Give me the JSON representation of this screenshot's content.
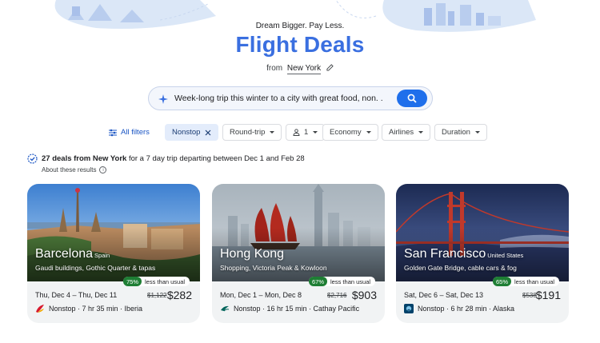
{
  "header": {
    "tagline": "Dream Bigger. Pay Less.",
    "title": "Flight Deals",
    "from_label": "from",
    "from_city": "New York"
  },
  "search": {
    "query": "Week-long trip this winter to a city with great food, non. ."
  },
  "filters": {
    "all_filters": "All filters",
    "nonstop": "Nonstop",
    "round_trip": "Round-trip",
    "passengers": "1",
    "cabin": "Economy",
    "airlines": "Airlines",
    "duration": "Duration"
  },
  "results": {
    "count_text": "27 deals from New York",
    "detail_text": " for a 7 day trip departing between Dec 1 and Feb 28",
    "about": "About these results",
    "info_glyph": "i"
  },
  "deals": [
    {
      "city": "Barcelona",
      "country": "Spain",
      "description": "Gaudi buildings, Gothic Quarter & tapas",
      "discount": "75%",
      "discount_label": "less than usual",
      "dates": "Thu, Dec 4 – Thu, Dec 11",
      "old_price": "$1,122",
      "price": "$282",
      "flight": "Nonstop · 7 hr 35 min · Iberia",
      "airline_icon": "iberia-logo-icon"
    },
    {
      "city": "Hong Kong",
      "country": "",
      "description": "Shopping, Victoria Peak & Kowloon",
      "discount": "67%",
      "discount_label": "less than usual",
      "dates": "Mon, Dec 1 – Mon, Dec 8",
      "old_price": "$2,716",
      "price": "$903",
      "flight": "Nonstop · 16 hr 15 min · Cathay Pacific",
      "airline_icon": "cathay-pacific-logo-icon"
    },
    {
      "city": "San Francisco",
      "country": "United States",
      "description": "Golden Gate Bridge, cable cars & fog",
      "discount": "65%",
      "discount_label": "less than usual",
      "dates": "Sat, Dec 6 – Sat, Dec 13",
      "old_price": "$538",
      "price": "$191",
      "flight": "Nonstop · 6 hr 28 min · Alaska",
      "airline_icon": "alaska-logo-icon"
    }
  ],
  "colors": {
    "accent": "#3a6fe0",
    "search_button": "#1f6feb",
    "discount_badge": "#1e7e34"
  }
}
